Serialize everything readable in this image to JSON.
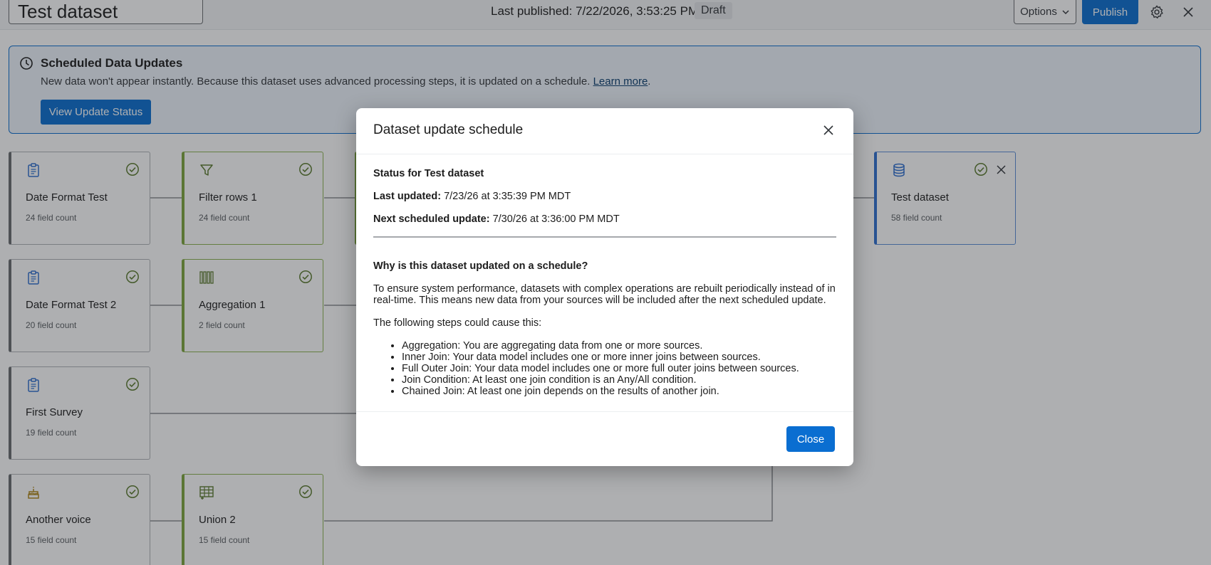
{
  "header": {
    "dataset_title": "Test dataset",
    "last_published": "Last published: 7/22/2026, 3:53:25 PM",
    "status_badge": "Draft",
    "options_label": "Options",
    "publish_label": "Publish"
  },
  "banner": {
    "title": "Scheduled Data Updates",
    "text": "New data won't appear instantly. Because this dataset uses advanced processing steps, it is updated on a schedule.",
    "link": "Learn more",
    "link_suffix": ".",
    "button": "View Update Status"
  },
  "nodes": [
    {
      "name": "Date Format Test",
      "count": "24 field count"
    },
    {
      "name": "Filter rows 1",
      "count": "24 field count"
    },
    {
      "name": "Test dataset",
      "count": "58 field count"
    },
    {
      "name": "Date Format Test 2",
      "count": "20 field count"
    },
    {
      "name": "Aggregation 1",
      "count": "2 field count"
    },
    {
      "name": "First Survey",
      "count": "19 field count"
    },
    {
      "name": "Another voice",
      "count": "15 field count"
    },
    {
      "name": "Union 2",
      "count": "15 field count"
    }
  ],
  "dialog": {
    "title": "Dataset update schedule",
    "status_heading": "Status for Test dataset",
    "last_updated_label": "Last updated:",
    "last_updated_value": "7/23/26 at 3:35:39 PM MDT",
    "next_update_label": "Next scheduled update:",
    "next_update_value": "7/30/26 at 3:36:00 PM MDT",
    "why_heading": "Why is this dataset updated on a schedule?",
    "explanation_line1": "To ensure system performance, datasets with complex operations are rebuilt periodically instead of in",
    "explanation_line2": "real-time. This means new data from your sources will be included after the next scheduled update.",
    "steps_intro": "The following steps could cause this:",
    "steps": [
      "Aggregation: You are aggregating data from one or more sources.",
      "Inner Join: Your data model includes one or more inner joins between sources.",
      "Full Outer Join: Your data model includes one or more full outer joins between sources.",
      "Join Condition: At least one join condition is an Any/All condition.",
      "Chained Join: At least one join depends on the results of another join."
    ],
    "close_label": "Close"
  },
  "colors": {
    "primary": "#0a6ed1",
    "success": "#5b7b2e",
    "transform_border": "#7ea63d",
    "output_border": "#2e6fd1"
  }
}
